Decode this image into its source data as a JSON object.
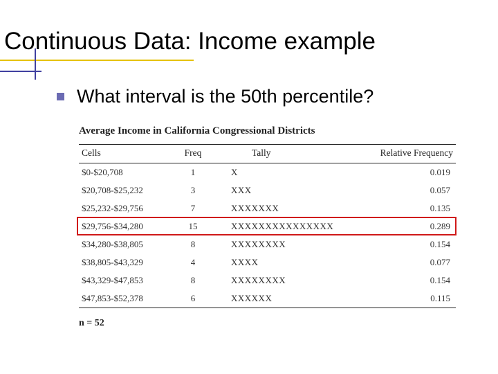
{
  "slide": {
    "title": "Continuous Data: Income example",
    "bullet": "What interval is the 50th percentile?"
  },
  "table": {
    "title": "Average Income in California Congressional Districts",
    "headers": {
      "cells": "Cells",
      "freq": "Freq",
      "tally": "Tally",
      "relfreq": "Relative Frequency"
    },
    "rows": [
      {
        "cells": "$0-$20,708",
        "freq": "1",
        "tally": "X",
        "relfreq": "0.019",
        "highlight": false
      },
      {
        "cells": "$20,708-$25,232",
        "freq": "3",
        "tally": "XXX",
        "relfreq": "0.057",
        "highlight": false
      },
      {
        "cells": "$25,232-$29,756",
        "freq": "7",
        "tally": "XXXXXXX",
        "relfreq": "0.135",
        "highlight": false
      },
      {
        "cells": "$29,756-$34,280",
        "freq": "15",
        "tally": "XXXXXXXXXXXXXXX",
        "relfreq": "0.289",
        "highlight": true
      },
      {
        "cells": "$34,280-$38,805",
        "freq": "8",
        "tally": "XXXXXXXX",
        "relfreq": "0.154",
        "highlight": false
      },
      {
        "cells": "$38,805-$43,329",
        "freq": "4",
        "tally": "XXXX",
        "relfreq": "0.077",
        "highlight": false
      },
      {
        "cells": "$43,329-$47,853",
        "freq": "8",
        "tally": "XXXXXXXX",
        "relfreq": "0.154",
        "highlight": false
      },
      {
        "cells": "$47,853-$52,378",
        "freq": "6",
        "tally": "XXXXXX",
        "relfreq": "0.115",
        "highlight": false
      }
    ],
    "n_label": "n = 52"
  },
  "chart_data": {
    "type": "table",
    "title": "Average Income in California Congressional Districts",
    "columns": [
      "Cells",
      "Freq",
      "Tally",
      "Relative Frequency"
    ],
    "rows": [
      [
        "$0-$20,708",
        1,
        "X",
        0.019
      ],
      [
        "$20,708-$25,232",
        3,
        "XXX",
        0.057
      ],
      [
        "$25,232-$29,756",
        7,
        "XXXXXXX",
        0.135
      ],
      [
        "$29,756-$34,280",
        15,
        "XXXXXXXXXXXXXXX",
        0.289
      ],
      [
        "$34,280-$38,805",
        8,
        "XXXXXXXX",
        0.154
      ],
      [
        "$38,805-$43,329",
        4,
        "XXXX",
        0.077
      ],
      [
        "$43,329-$47,853",
        8,
        "XXXXXXXX",
        0.154
      ],
      [
        "$47,853-$52,378",
        6,
        "XXXXXX",
        0.115
      ]
    ],
    "n": 52,
    "highlighted_row_index": 3
  }
}
